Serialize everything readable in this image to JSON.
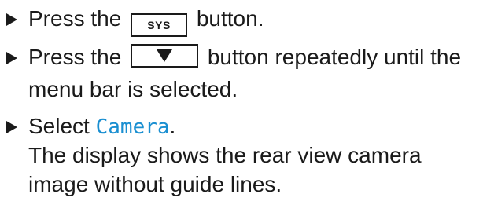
{
  "steps": [
    {
      "before": "Press the",
      "key_label": "SYS",
      "after": "button."
    },
    {
      "before": "Press the",
      "key_icon": "down-triangle-icon",
      "after": "button repeatedly until the",
      "continuation": "menu bar is selected."
    },
    {
      "before": "Select",
      "menu_term": "Camera",
      "after": ".",
      "result_line1": "The display shows the rear view camera",
      "result_line2": "image without guide lines."
    }
  ],
  "colors": {
    "text": "#1a1a1a",
    "menu_term": "#1a8fd1"
  }
}
